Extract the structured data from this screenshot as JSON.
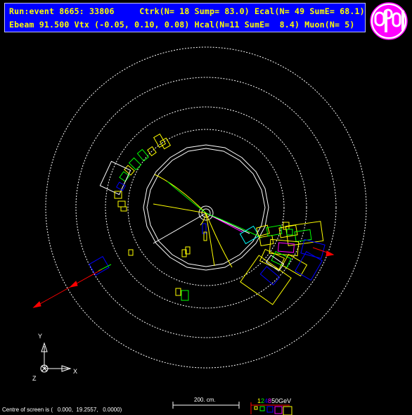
{
  "header": {
    "line1": "Run:event 8665: 33806     Ctrk(N= 18 Sump= 83.0) Ecal(N= 49 SumE= 68.1)",
    "line2": "Ebeam 91.500 Vtx (-0.05, 0.10, 0.08) Hcal(N=11 SumE=  8.4) Muon(N= 5)"
  },
  "axes": {
    "y": "Y",
    "x": "X",
    "z": "Z"
  },
  "footer": {
    "centre": "Centre of screen is (   0.000,  19.2557,   0.0000)",
    "scale": "200. cm.",
    "energy_digits": [
      "1",
      "2",
      "4",
      "8",
      "50"
    ],
    "energy_unit": "GeV"
  },
  "colors": {
    "header_bg": "#0000ff",
    "header_text": "#ffff00",
    "track": "#ffff00",
    "ecal": "#ffff00",
    "hcal": "#0000ff",
    "muon": "#ff0000",
    "detector": "#ffffff"
  }
}
